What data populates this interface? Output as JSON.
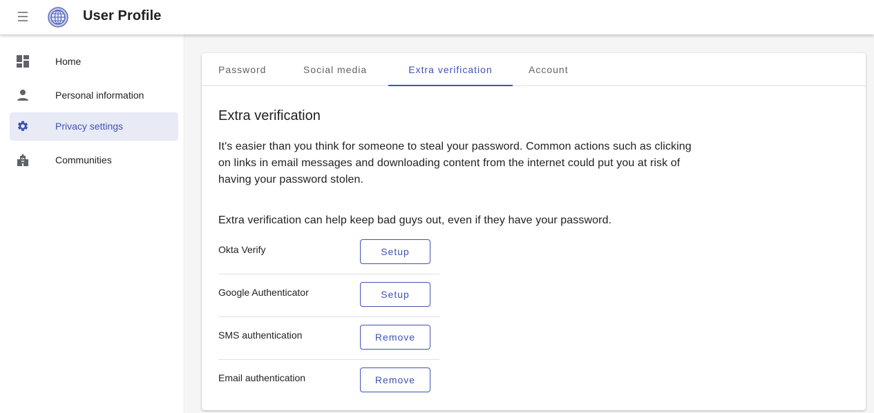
{
  "header": {
    "title": "User Profile",
    "menu_icon": "hamburger-icon",
    "logo_icon": "globe-logo-icon"
  },
  "sidebar": {
    "items": [
      {
        "label": "Home",
        "icon": "dashboard-icon",
        "active": false
      },
      {
        "label": "Personal information",
        "icon": "person-icon",
        "active": false
      },
      {
        "label": "Privacy settings",
        "icon": "gear-icon",
        "active": true
      },
      {
        "label": "Communities",
        "icon": "building-icon",
        "active": false
      }
    ]
  },
  "tabs": [
    {
      "label": "Password",
      "active": false
    },
    {
      "label": "Social media",
      "active": false
    },
    {
      "label": "Extra verification",
      "active": true
    },
    {
      "label": "Account",
      "active": false
    }
  ],
  "content": {
    "title": "Extra verification",
    "description": "It's easier than you think for someone to steal your password. Common actions such as clicking on links in email messages and downloading content from the internet could put you at risk of having your password stolen.",
    "description2": "Extra verification can help keep bad guys out, even if they have your password.",
    "methods": [
      {
        "label": "Okta Verify",
        "button": "Setup"
      },
      {
        "label": "Google Authenticator",
        "button": "Setup"
      },
      {
        "label": "SMS authentication",
        "button": "Remove"
      },
      {
        "label": "Email authentication",
        "button": "Remove"
      }
    ]
  },
  "colors": {
    "accent": "#3f51b5",
    "active_bg": "#e8eaf6",
    "icon_gray": "#5f6368",
    "background": "#f5f5f5"
  }
}
